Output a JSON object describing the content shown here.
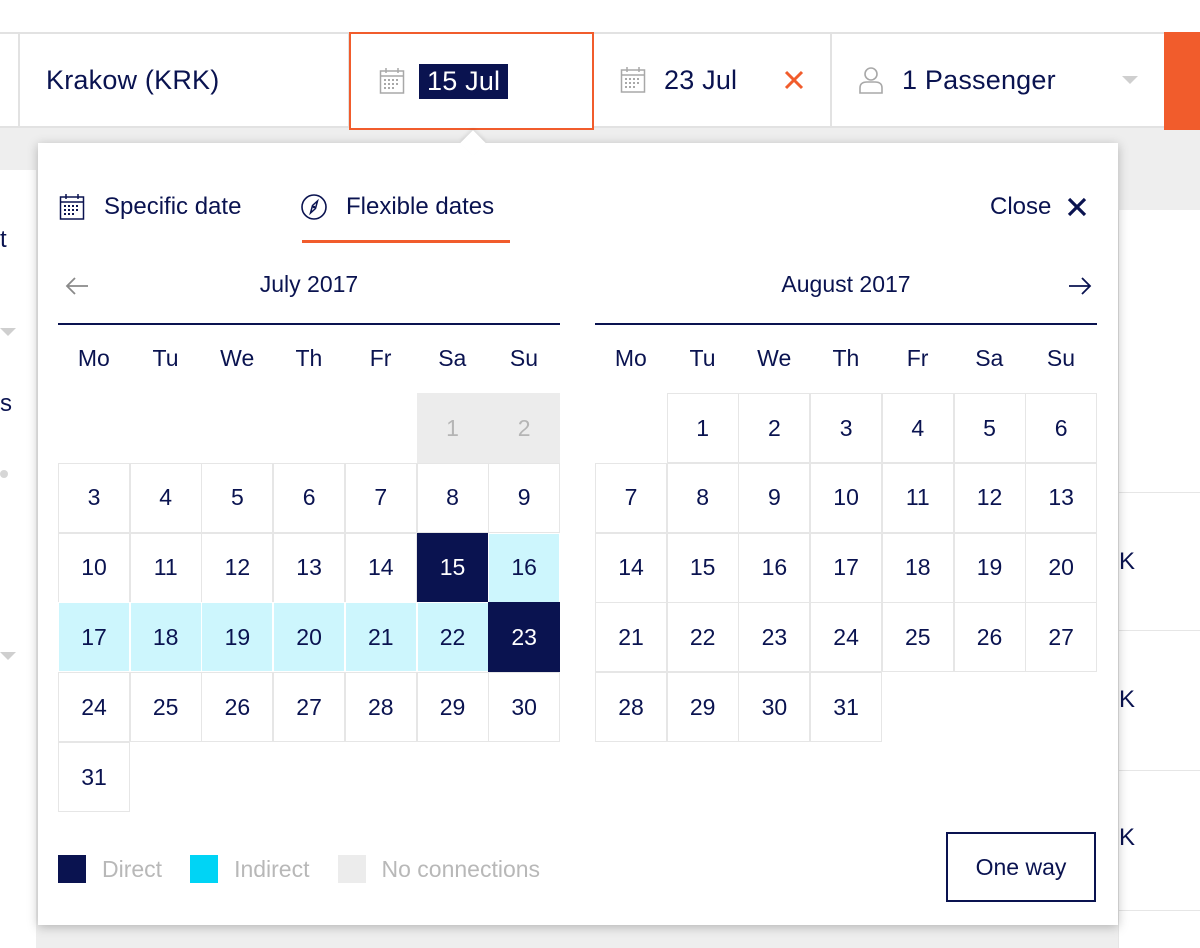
{
  "search": {
    "destination": "Krakow (KRK)",
    "outbound_date": "15 Jul",
    "return_date": "23 Jul",
    "passengers": "1 Passenger"
  },
  "background_fragments": {
    "left": [
      "t",
      "s"
    ],
    "right": [
      "K",
      "K",
      "K"
    ]
  },
  "datepicker": {
    "tabs": {
      "specific": "Specific date",
      "flexible": "Flexible dates",
      "active": "flexible"
    },
    "close_label": "Close",
    "weekdays": [
      "Mo",
      "Tu",
      "We",
      "Th",
      "Fr",
      "Sa",
      "Su"
    ],
    "months": [
      {
        "title": "July 2017",
        "first_weekday": 5,
        "days": 31,
        "no_connection_days": [
          1,
          2
        ],
        "selected_days": [
          15,
          23
        ],
        "range_days": [
          16,
          17,
          18,
          19,
          20,
          21,
          22
        ]
      },
      {
        "title": "August 2017",
        "first_weekday": 1,
        "days": 31,
        "no_connection_days": [],
        "selected_days": [],
        "range_days": []
      }
    ],
    "legend": [
      {
        "label": "Direct",
        "color": "#0a1350"
      },
      {
        "label": "Indirect",
        "color": "#00d4f5"
      },
      {
        "label": "No connections",
        "color": "#ececec"
      }
    ],
    "one_way_label": "One way"
  },
  "colors": {
    "accent": "#f15c2c",
    "navy": "#0a1350",
    "range": "#cdf6fd"
  }
}
